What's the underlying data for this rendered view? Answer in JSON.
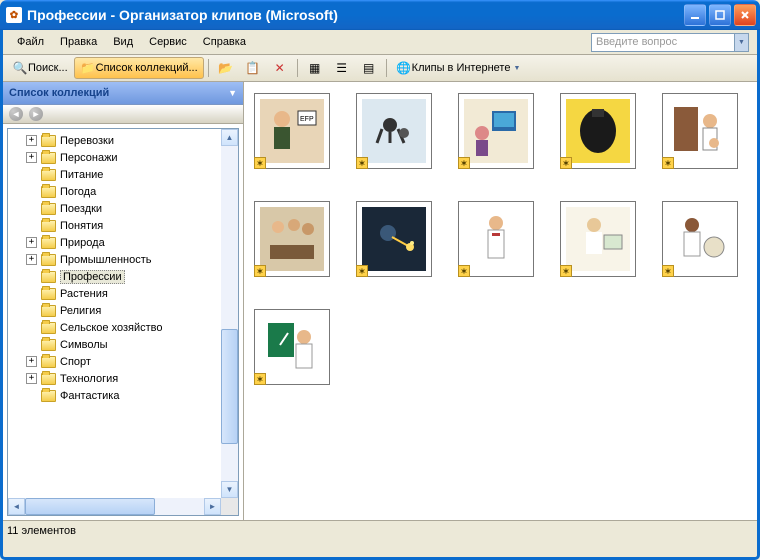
{
  "title": "Профессии - Организатор клипов (Microsoft)",
  "menu": {
    "file": "Файл",
    "edit": "Правка",
    "view": "Вид",
    "service": "Сервис",
    "help": "Справка"
  },
  "ask_placeholder": "Введите вопрос",
  "toolbar": {
    "search": "Поиск...",
    "collections": "Список коллекций...",
    "clips_online": "Клипы в Интернете"
  },
  "pane_title": "Список коллекций",
  "tree": [
    {
      "label": "Перевозки",
      "expand": "+"
    },
    {
      "label": "Персонажи",
      "expand": "+"
    },
    {
      "label": "Питание",
      "expand": ""
    },
    {
      "label": "Погода",
      "expand": ""
    },
    {
      "label": "Поездки",
      "expand": ""
    },
    {
      "label": "Понятия",
      "expand": ""
    },
    {
      "label": "Природа",
      "expand": "+"
    },
    {
      "label": "Промышленность",
      "expand": "+"
    },
    {
      "label": "Профессии",
      "expand": "",
      "selected": true
    },
    {
      "label": "Растения",
      "expand": ""
    },
    {
      "label": "Религия",
      "expand": ""
    },
    {
      "label": "Сельское хозяйство",
      "expand": ""
    },
    {
      "label": "Символы",
      "expand": ""
    },
    {
      "label": "Спорт",
      "expand": "+"
    },
    {
      "label": "Технология",
      "expand": "+"
    },
    {
      "label": "Фантастика",
      "expand": ""
    }
  ],
  "status": "11 элементов",
  "thumbs_count": 11
}
